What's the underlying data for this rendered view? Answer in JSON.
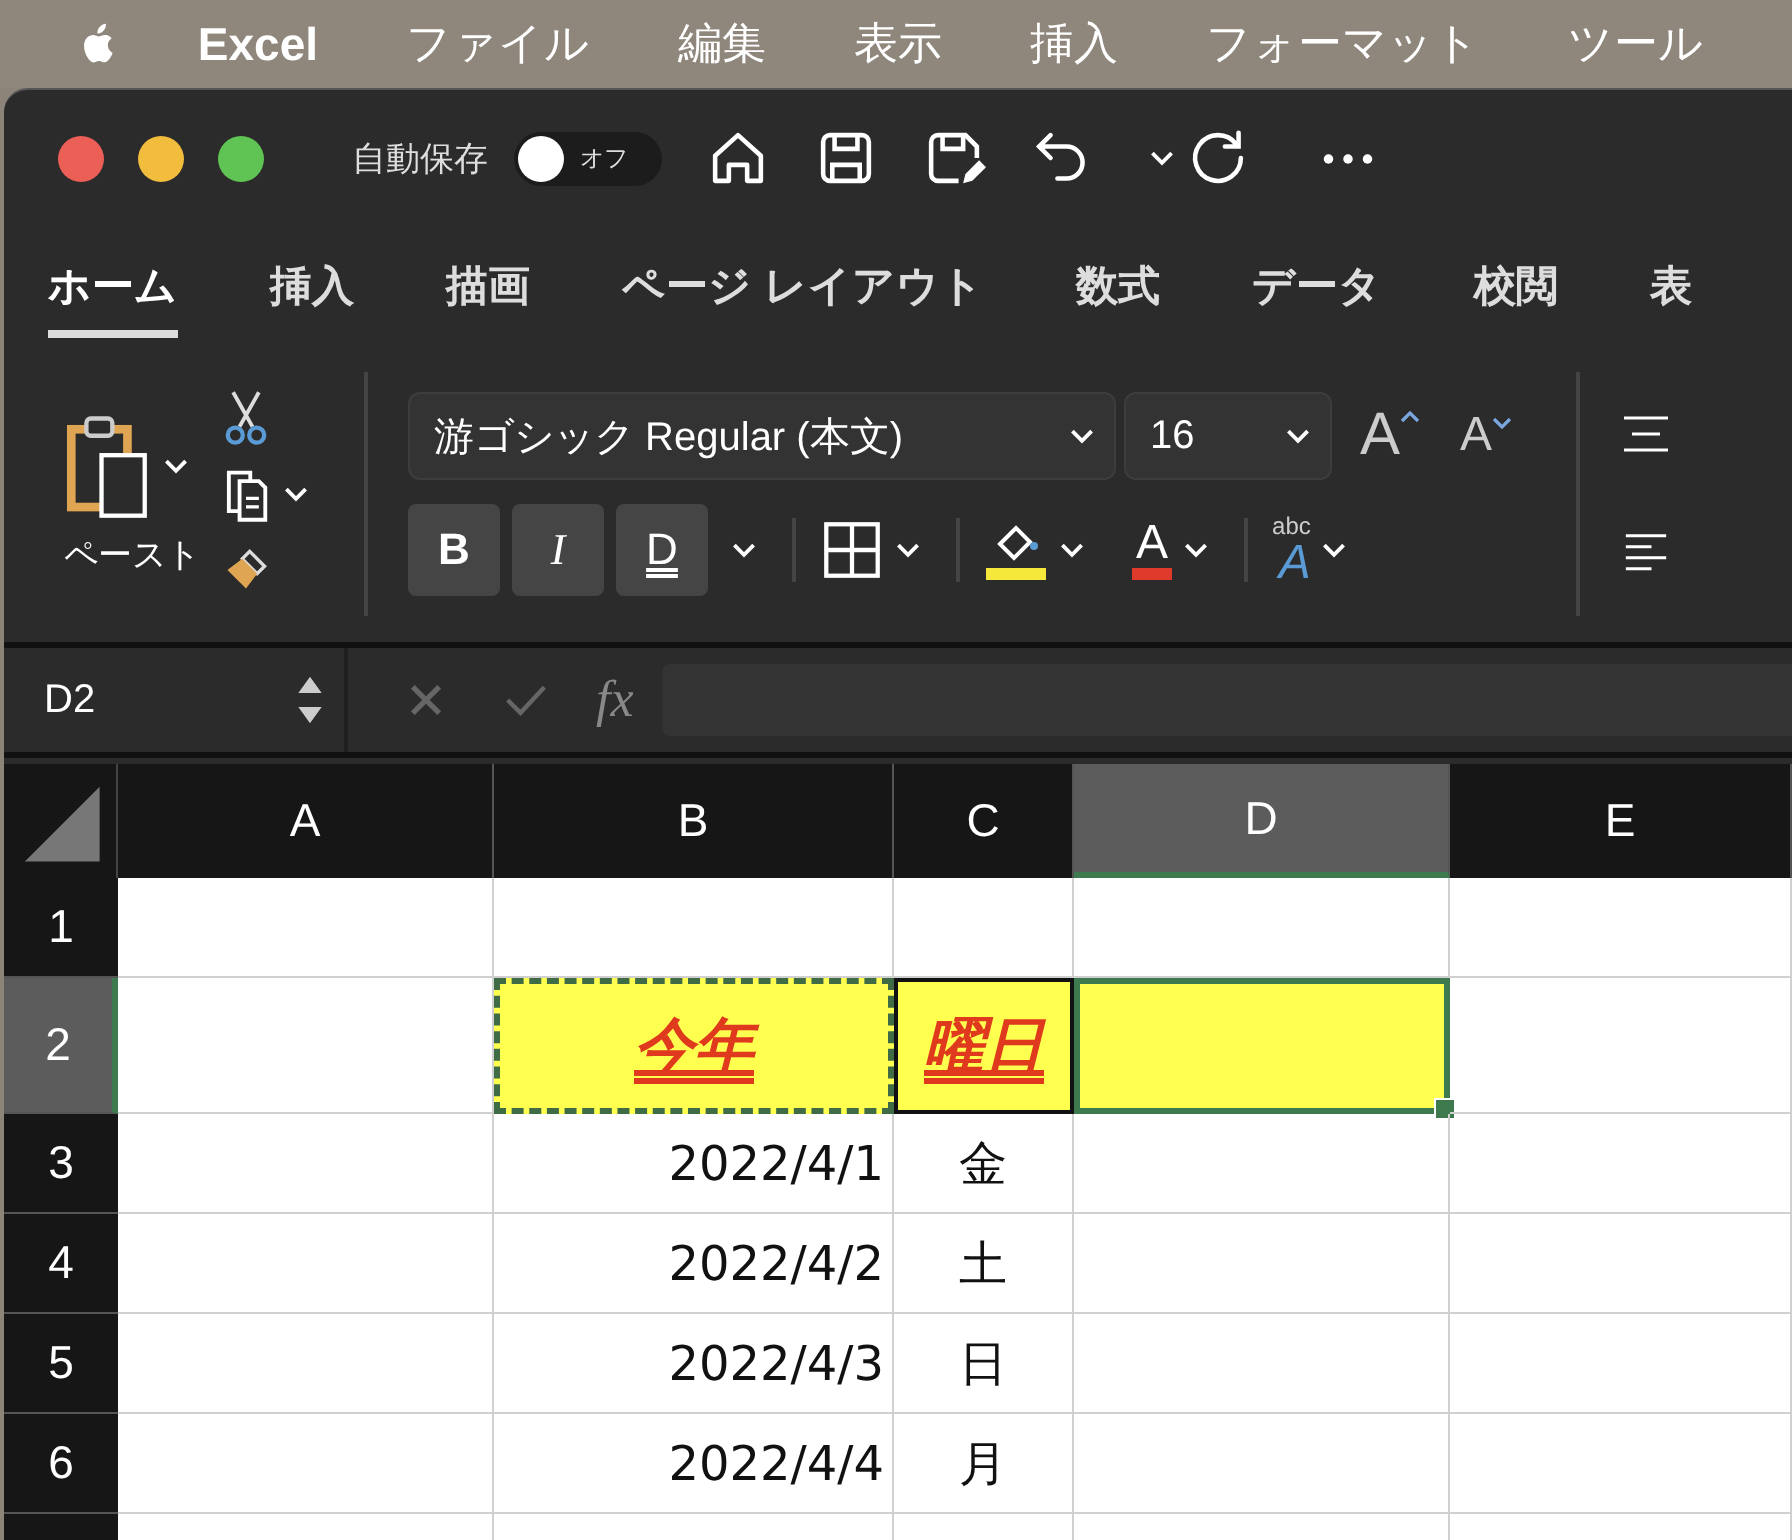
{
  "menu_bar": {
    "app": "Excel",
    "items": [
      "ファイル",
      "編集",
      "表示",
      "挿入",
      "フォーマット",
      "ツール"
    ]
  },
  "title_bar": {
    "autosave": {
      "label": "自動保存",
      "on": false,
      "state_label": "オフ"
    }
  },
  "tabs": [
    {
      "label": "ホーム",
      "selected": true
    },
    {
      "label": "挿入",
      "selected": false
    },
    {
      "label": "描画",
      "selected": false
    },
    {
      "label": "ページ レイアウト",
      "selected": false
    },
    {
      "label": "数式",
      "selected": false
    },
    {
      "label": "データ",
      "selected": false
    },
    {
      "label": "校閲",
      "selected": false
    },
    {
      "label": "表",
      "selected": false
    }
  ],
  "ribbon": {
    "paste_label": "ペースト",
    "font_name": "游ゴシック Regular (本文)",
    "font_size": "16",
    "grow_glyph": "A",
    "shrink_glyph": "A",
    "styles": [
      {
        "glyph": "B",
        "kind": "bold",
        "on": true
      },
      {
        "glyph": "I",
        "kind": "italic",
        "on": true
      },
      {
        "glyph": "D",
        "kind": "underline",
        "on": true
      }
    ],
    "font_color_glyph": "A",
    "text_effect_small": "abc",
    "text_effect_glyph": "A"
  },
  "formula_bar": {
    "name_box": "D2",
    "fx": "fx"
  },
  "sheet": {
    "columns": [
      {
        "label": "A",
        "selected": false
      },
      {
        "label": "B",
        "selected": false
      },
      {
        "label": "C",
        "selected": false
      },
      {
        "label": "D",
        "selected": true
      },
      {
        "label": "E",
        "selected": false
      }
    ],
    "rows": [
      {
        "label": "1",
        "selected": false,
        "cells": [
          {
            "kind": "blank"
          },
          {
            "kind": "blank"
          },
          {
            "kind": "blank"
          },
          {
            "kind": "blank"
          },
          {
            "kind": "blank"
          }
        ]
      },
      {
        "label": "2",
        "selected": true,
        "cells": [
          {
            "kind": "blank"
          },
          {
            "kind": "title",
            "text": "今年",
            "copied": true
          },
          {
            "kind": "title",
            "text": "曜日",
            "copied": false
          },
          {
            "kind": "highlight",
            "selected": true
          },
          {
            "kind": "blank"
          }
        ]
      },
      {
        "label": "3",
        "selected": false,
        "cells": [
          {
            "kind": "blank"
          },
          {
            "kind": "date",
            "text": "2022/4/1"
          },
          {
            "kind": "center",
            "text": "金"
          },
          {
            "kind": "blank"
          },
          {
            "kind": "blank"
          }
        ]
      },
      {
        "label": "4",
        "selected": false,
        "cells": [
          {
            "kind": "blank"
          },
          {
            "kind": "date",
            "text": "2022/4/2"
          },
          {
            "kind": "center",
            "text": "土"
          },
          {
            "kind": "blank"
          },
          {
            "kind": "blank"
          }
        ]
      },
      {
        "label": "5",
        "selected": false,
        "cells": [
          {
            "kind": "blank"
          },
          {
            "kind": "date",
            "text": "2022/4/3"
          },
          {
            "kind": "center",
            "text": "日"
          },
          {
            "kind": "blank"
          },
          {
            "kind": "blank"
          }
        ]
      },
      {
        "label": "6",
        "selected": false,
        "cells": [
          {
            "kind": "blank"
          },
          {
            "kind": "date",
            "text": "2022/4/4"
          },
          {
            "kind": "center",
            "text": "月"
          },
          {
            "kind": "blank"
          },
          {
            "kind": "blank"
          }
        ]
      }
    ]
  }
}
